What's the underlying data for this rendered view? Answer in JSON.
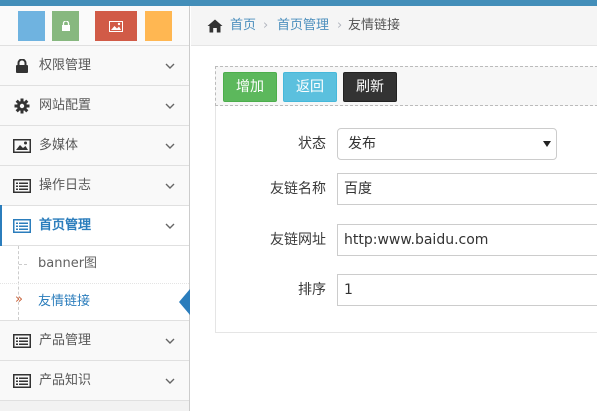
{
  "breadcrumb": {
    "home": "首页",
    "sep": "›",
    "section": "首页管理",
    "current": "友情链接"
  },
  "sidebar": {
    "items": [
      {
        "label": "权限管理",
        "icon": "lock-icon"
      },
      {
        "label": "网站配置",
        "icon": "gear-icon"
      },
      {
        "label": "多媒体",
        "icon": "picture-icon"
      },
      {
        "label": "操作日志",
        "icon": "list-icon"
      },
      {
        "label": "首页管理",
        "icon": "list-icon"
      },
      {
        "label": "产品管理",
        "icon": "list-icon"
      },
      {
        "label": "产品知识",
        "icon": "list-icon"
      }
    ],
    "submenu": [
      {
        "label": "banner图"
      },
      {
        "label": "友情链接",
        "marker": "»"
      }
    ]
  },
  "toolbar": {
    "add_label": "增加",
    "back_label": "返回",
    "refresh_label": "刷新"
  },
  "form": {
    "status": {
      "label": "状态",
      "value": "发布"
    },
    "name": {
      "label": "友链名称",
      "value": "百度"
    },
    "url": {
      "label": "友链网址",
      "value": "http:www.baidu.com"
    },
    "order": {
      "label": "排序",
      "value": "1"
    }
  },
  "colors": {
    "accent": "#2b7dbc",
    "add": "#5cb85c",
    "back": "#5bc0de",
    "refresh": "#333333"
  }
}
